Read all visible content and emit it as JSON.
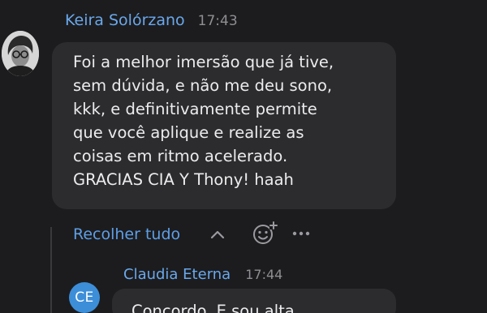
{
  "message": {
    "author": "Keira Solórzano",
    "time": "17:43",
    "lines": [
      "Foi a melhor imersão que já tive,",
      "sem dúvida, e não me deu sono,",
      "kkk, e definitivamente permite",
      "que você aplique e realize as",
      "coisas em ritmo acelerado.",
      "GRACIAS CIA Y Thony! haah"
    ]
  },
  "thread": {
    "collapse_label": "Recolher tudo",
    "icons": [
      "chevron-up-icon",
      "add-reaction-icon",
      "more-options-icon"
    ]
  },
  "reply": {
    "author": "Claudia Eterna",
    "time": "17:44",
    "initials": "CE",
    "text": "Concordo. E sou alta"
  },
  "colors": {
    "background": "#1c1c1e",
    "bubble": "#2c2c2e",
    "name": "#6aa8ec",
    "link": "#5e9fe6",
    "avatar_initials_bg": "#3d8ed8"
  }
}
